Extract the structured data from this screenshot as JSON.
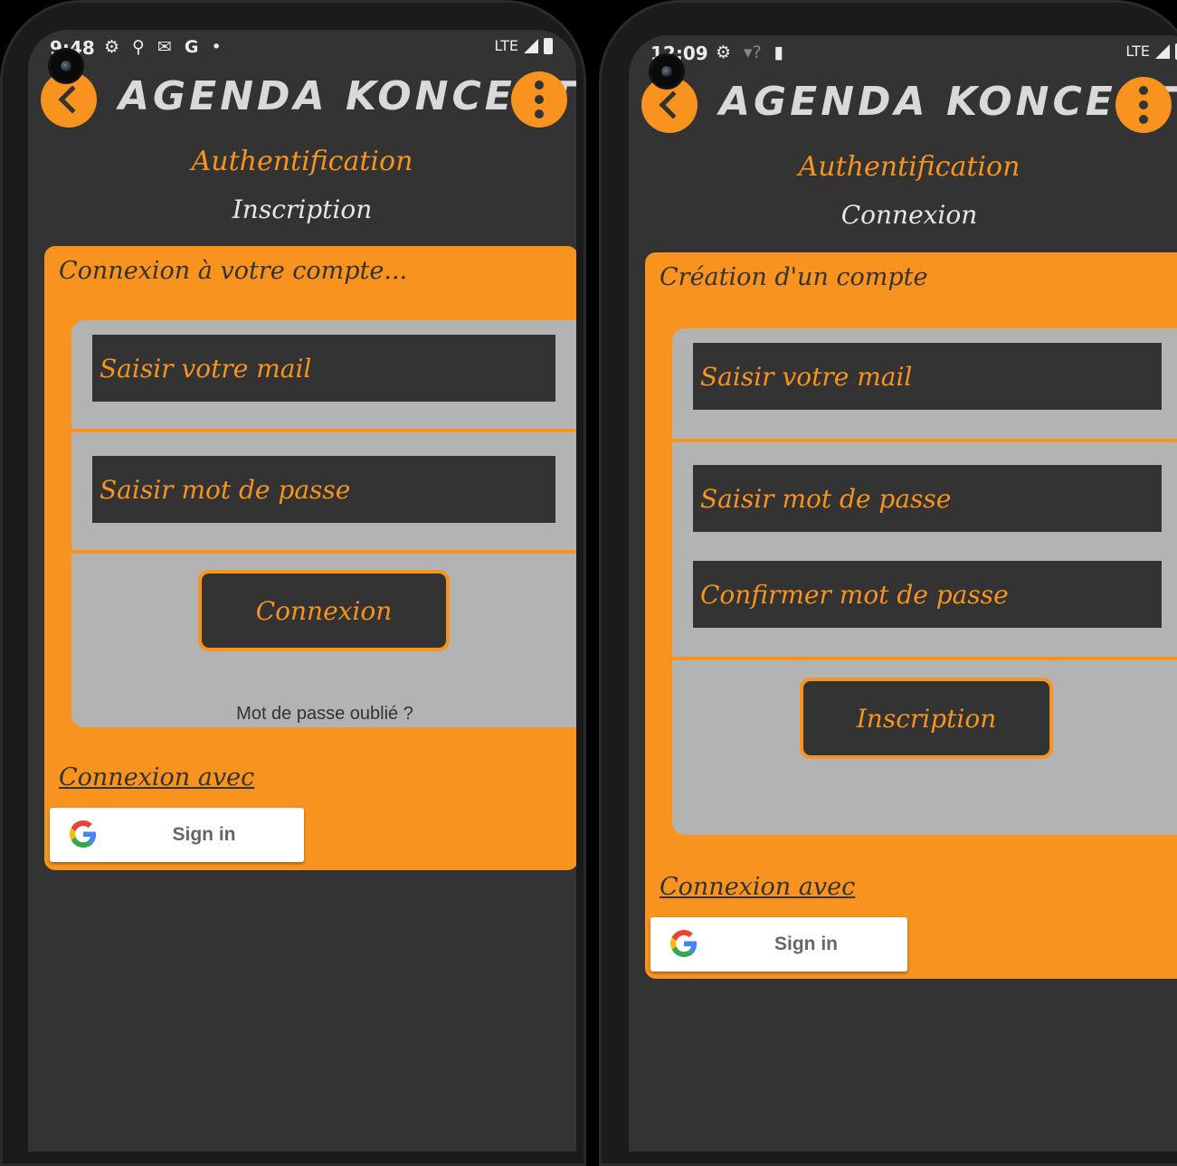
{
  "app": {
    "title": "AGENDA KONCERT",
    "accent_color": "#f7931e",
    "background_color": "#333333",
    "form_color": "#b3b3b3"
  },
  "screens": [
    {
      "status": {
        "time": "9:48",
        "icons": [
          "gear-icon",
          "location-icon",
          "gmail-icon",
          "google-icon",
          "dot-icon"
        ],
        "network": "LTE"
      },
      "page_title": "Authentification",
      "switch_link": "Inscription",
      "card_title": "Connexion à votre compte...",
      "email_placeholder": "Saisir votre mail",
      "password_placeholder": "Saisir mot de passe",
      "submit_label": "Connexion",
      "forgot_label": "Mot de passe oublié ?",
      "social_label": "Connexion avec",
      "google_label": "Sign in"
    },
    {
      "status": {
        "time": "12:09",
        "icons": [
          "gear-icon",
          "wifi-question-icon",
          "sd-card-icon"
        ],
        "network": "LTE"
      },
      "page_title": "Authentification",
      "switch_link": "Connexion",
      "card_title": "Création d'un compte",
      "email_placeholder": "Saisir votre mail",
      "password_placeholder": "Saisir mot de passe",
      "confirm_placeholder": "Confirmer mot de passe",
      "submit_label": "Inscription",
      "social_label": "Connexion avec",
      "google_label": "Sign in"
    }
  ]
}
